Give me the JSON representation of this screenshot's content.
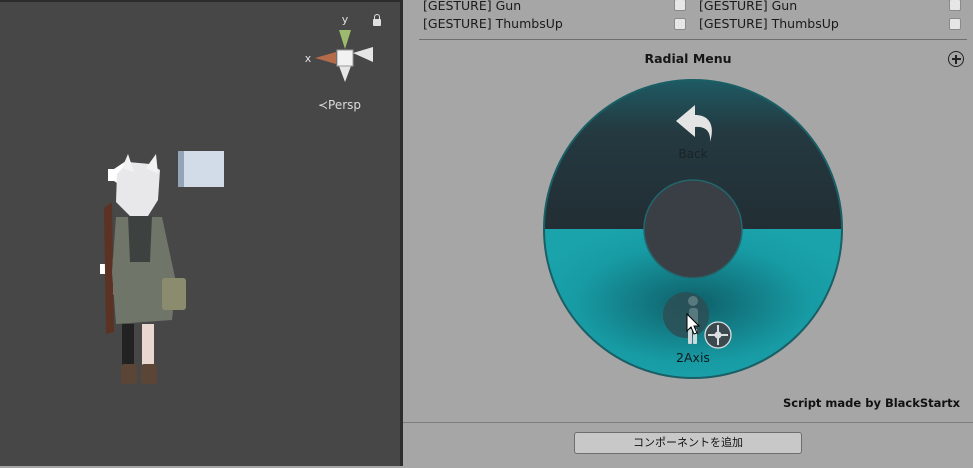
{
  "scene": {
    "axis_x": "x",
    "axis_y": "y",
    "projection": "≺Persp",
    "gizmo_colors": {
      "x": "#b36b4a",
      "y": "#9cbb6e",
      "z": "#e8e8e8"
    }
  },
  "inspector": {
    "gestures_left": [
      {
        "label": "[GESTURE] Gun",
        "checked": false
      },
      {
        "label": "[GESTURE] ThumbsUp",
        "checked": false
      }
    ],
    "gestures_right": [
      {
        "label": "[GESTURE] Gun",
        "checked": false
      },
      {
        "label": "[GESTURE] ThumbsUp",
        "checked": false
      }
    ],
    "radial_menu": {
      "title": "Radial Menu",
      "back_label": "Back",
      "axis_label": "2Axis",
      "colors": {
        "top": "#24343b",
        "bottom": "#1b9aa3",
        "rim": "#1a5e66",
        "center": "#3a3f46"
      }
    },
    "credit": "Script made by BlackStartx",
    "add_component": "コンポーネントを追加"
  }
}
